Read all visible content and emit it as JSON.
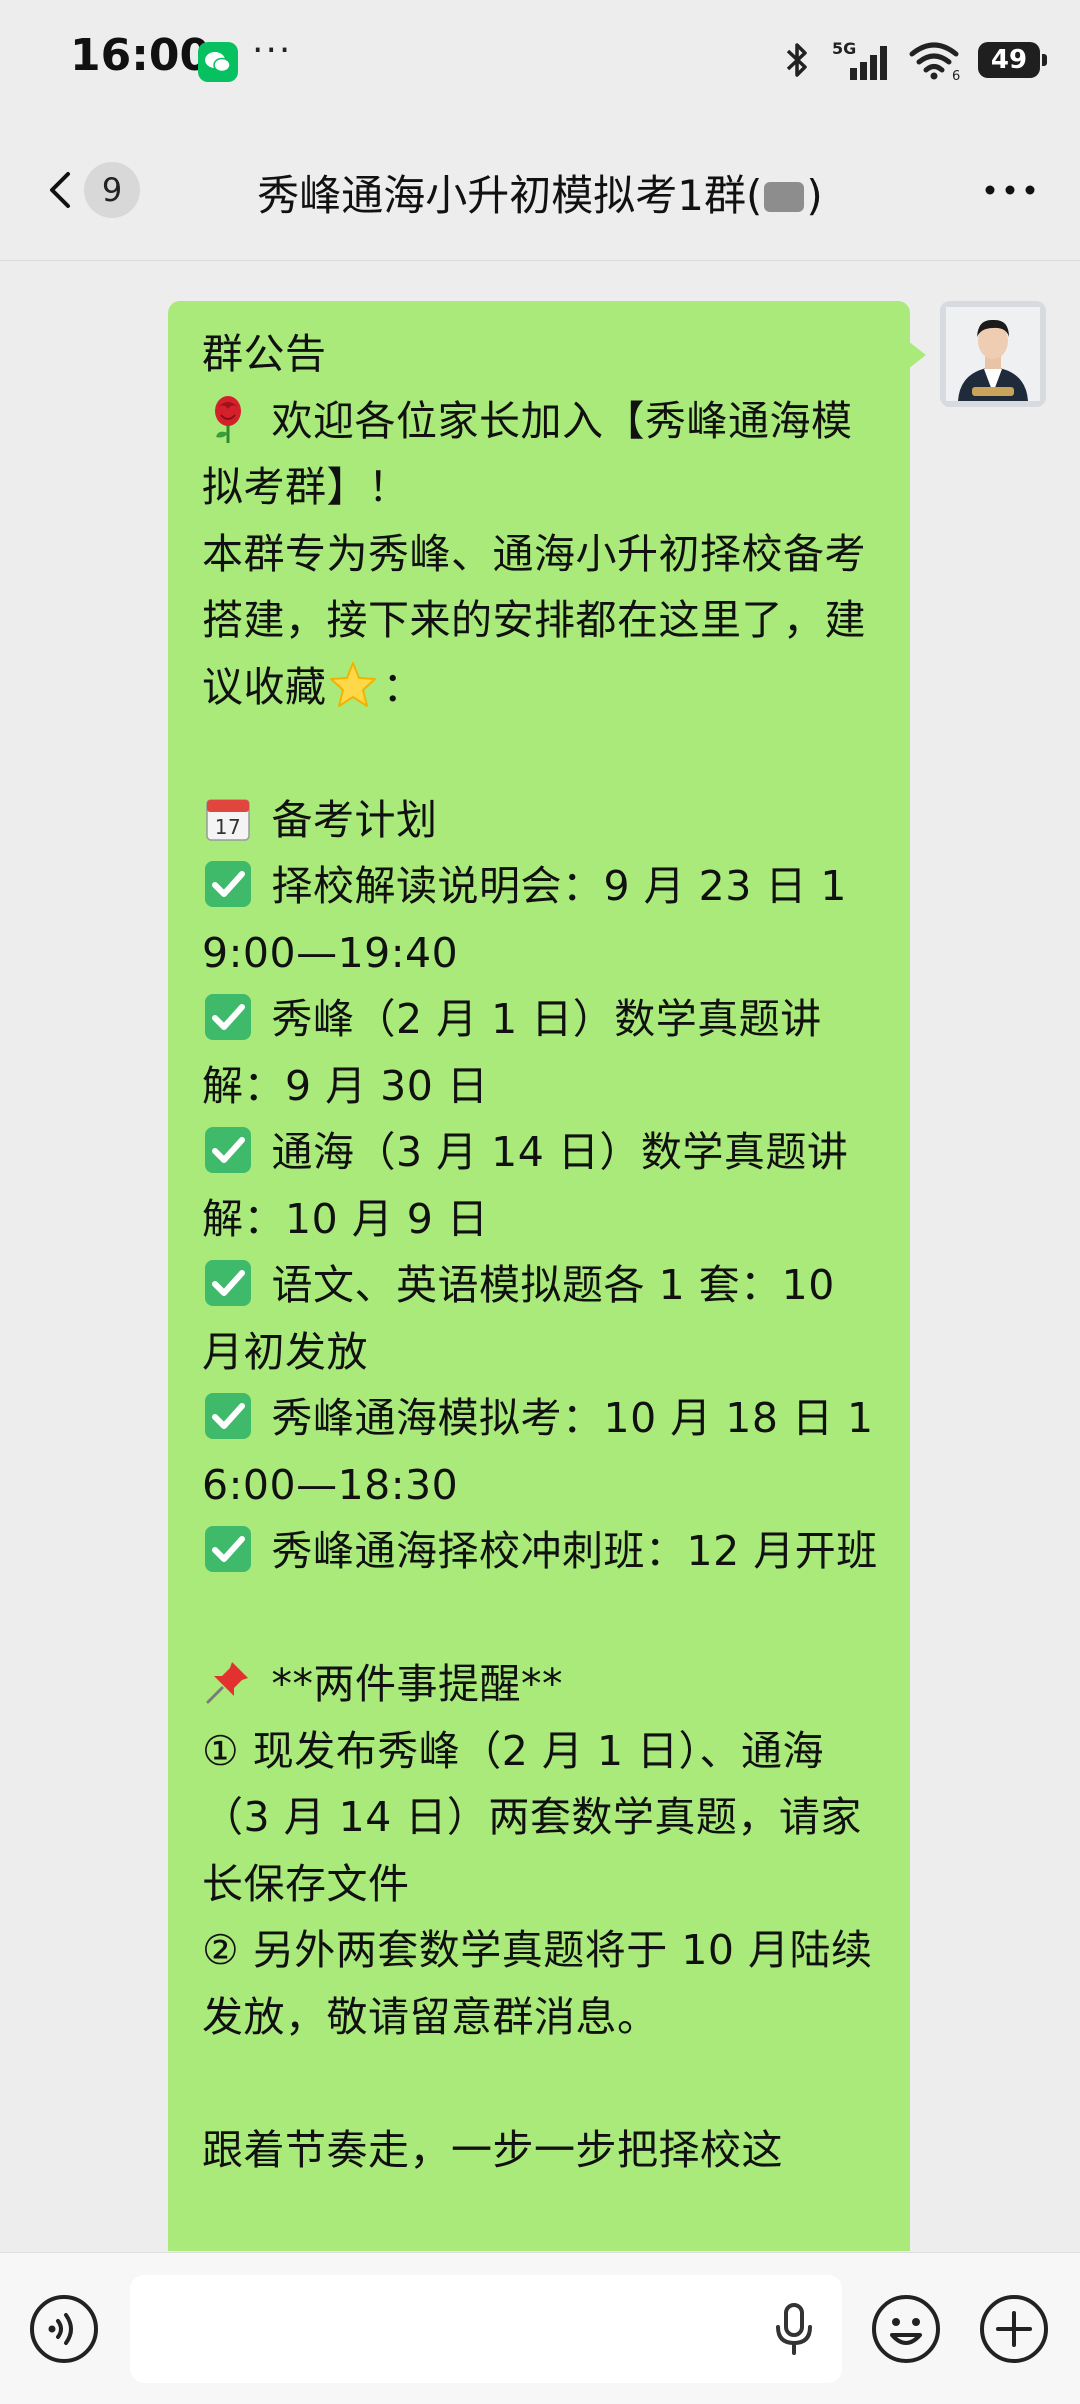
{
  "status_bar": {
    "time": "16:00",
    "dots": "···",
    "network": "5G",
    "battery": "49"
  },
  "nav": {
    "back_count": "9",
    "title_prefix": "秀峰通海小升初模拟考1群(",
    "title_suffix": ")"
  },
  "message": {
    "lines": [
      {
        "text": "群公告"
      },
      {
        "emoji": "rose-icon",
        "text": " 欢迎各位家长加入【秀峰通海模拟考群】！"
      },
      {
        "text": "本群专为秀峰、通海小升初择校备考搭建，接下来的安排都在这里了，建议收藏",
        "emoji_after": "star-icon",
        "tail": "："
      },
      {
        "text": " "
      },
      {
        "emoji": "calendar-icon",
        "text": " 备考计划"
      },
      {
        "emoji": "check-icon",
        "text": " 择校解读说明会：9 月 23 日 19:00—19:40"
      },
      {
        "emoji": "check-icon",
        "text": " 秀峰（2 月 1 日）数学真题讲解：9 月 30 日"
      },
      {
        "emoji": "check-icon",
        "text": " 通海（3 月 14 日）数学真题讲解：10 月 9 日"
      },
      {
        "emoji": "check-icon",
        "text": " 语文、英语模拟题各 1 套：10 月初发放"
      },
      {
        "emoji": "check-icon",
        "text": " 秀峰通海模拟考：10 月 18 日 16:00—18:30"
      },
      {
        "emoji": "check-icon",
        "text": " 秀峰通海择校冲刺班：12 月开班"
      },
      {
        "text": " "
      },
      {
        "emoji": "pin-icon",
        "text": " **两件事提醒**"
      },
      {
        "text": "① 现发布秀峰（2 月 1 日）、通海（3 月 14 日）两套数学真题，请家长保存文件"
      },
      {
        "text": "② 另外两套数学真题将于 10 月陆续发放，敬请留意群消息。"
      },
      {
        "text": " "
      },
      {
        "text": "跟着节奏走，一步一步把择校这"
      }
    ]
  },
  "colors": {
    "bubble": "#a9ea7a",
    "background": "#ededed",
    "wechat_green": "#07c160"
  }
}
